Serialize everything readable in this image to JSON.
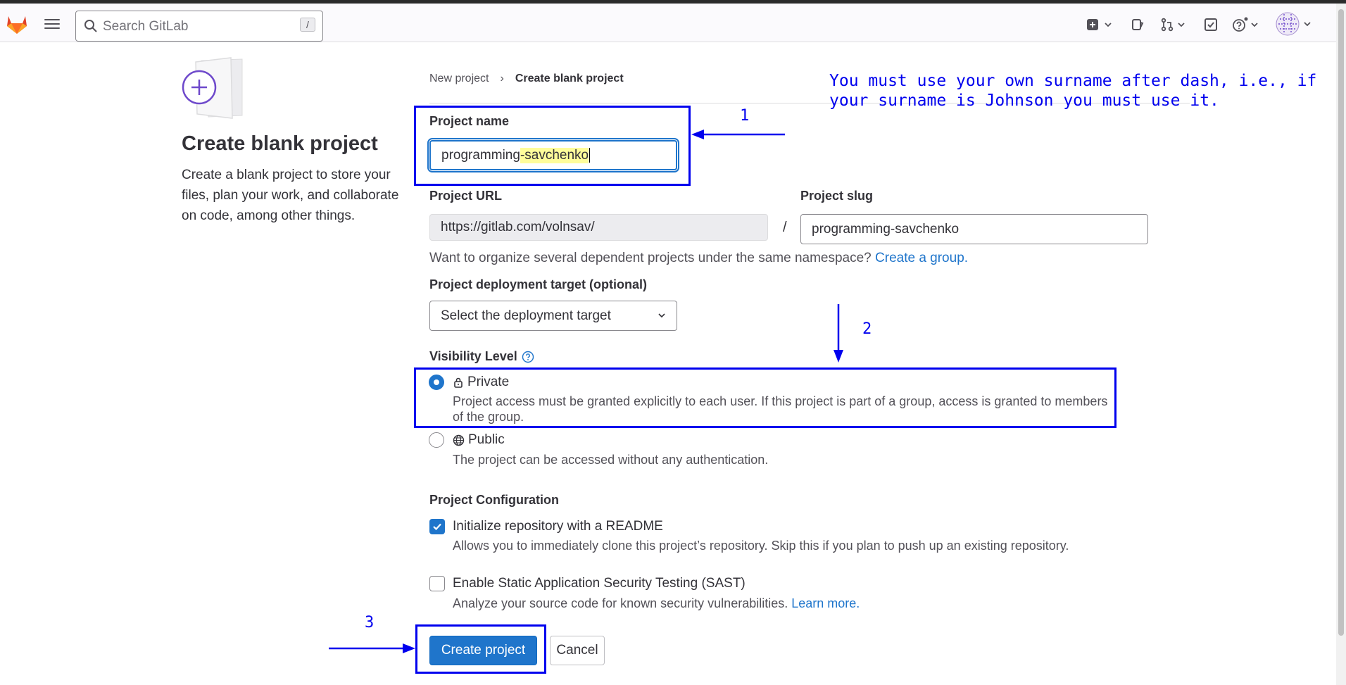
{
  "header": {
    "search_placeholder": "Search GitLab",
    "search_shortcut": "/"
  },
  "intro": {
    "title": "Create blank project",
    "description": "Create a blank project to store your files, plan your work, and collaborate on code, among other things."
  },
  "breadcrumb": {
    "parent": "New project",
    "current": "Create blank project"
  },
  "form": {
    "project_name_label": "Project name",
    "project_name_prefix": "programming",
    "project_name_suffix": "-savchenko",
    "project_url_label": "Project URL",
    "project_url_value": "https://gitlab.com/volnsav/",
    "url_separator": "/",
    "project_slug_label": "Project slug",
    "project_slug_value": "programming-savchenko",
    "namespace_help": "Want to organize several dependent projects under the same namespace?",
    "namespace_link": "Create a group.",
    "deployment_label": "Project deployment target (optional)",
    "deployment_selected": "Select the deployment target",
    "visibility_label": "Visibility Level",
    "visibility_options": [
      {
        "title": "Private",
        "icon": "lock-icon",
        "checked": true,
        "description": "Project access must be granted explicitly to each user. If this project is part of a group, access is granted to members of the group."
      },
      {
        "title": "Public",
        "icon": "globe-icon",
        "checked": false,
        "description": "The project can be accessed without any authentication."
      }
    ],
    "config_label": "Project Configuration",
    "readme_label": "Initialize repository with a README",
    "readme_checked": true,
    "readme_desc": "Allows you to immediately clone this project’s repository. Skip this if you plan to push up an existing repository.",
    "sast_label": "Enable Static Application Security Testing (SAST)",
    "sast_checked": false,
    "sast_desc": "Analyze your source code for known security vulnerabilities.",
    "sast_link": "Learn more.",
    "create_button": "Create project",
    "cancel_button": "Cancel"
  },
  "annotations": {
    "note": "You must use your own surname after dash, i.e., if your surname is Johnson you must use it.",
    "step1": "1",
    "step2": "2",
    "step3": "3",
    "color": "#0000ee"
  },
  "colors": {
    "primary": "#1f75cb",
    "highlight": "#fffd9a"
  }
}
